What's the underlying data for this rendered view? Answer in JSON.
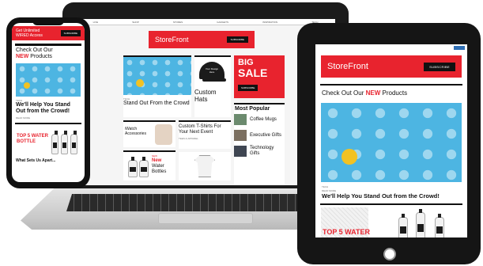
{
  "laptop": {
    "nav": [
      "LIVE",
      "SHOP",
      "STORES",
      "GADGETS",
      "INSPIRATION",
      "TECH"
    ],
    "banner": {
      "brand": "StoreFront",
      "button": "SUBSCRIBE"
    },
    "hero": {
      "tag": "TECH",
      "title": "Stand Out From the Crowd"
    },
    "hats": {
      "cap_text": "Your Design Here",
      "title": "Custom Hats"
    },
    "sale": {
      "line1": "BIG",
      "line2": "SALE",
      "button": "SUBSCRIBE"
    },
    "watch": {
      "title": "iWatch Accessories"
    },
    "tshirts": {
      "title": "Custom T-Shirts For Your Next Event",
      "tag": "TEES & APPAREL"
    },
    "bottles": {
      "tag": "NEW",
      "line1": "New",
      "line2": "Water",
      "line3": "Bottles"
    },
    "popular": {
      "title": "Most Popular",
      "items": [
        {
          "title": "Coffee Mugs"
        },
        {
          "title": "Executive Gifts"
        },
        {
          "title": "Technology Gifts"
        }
      ]
    }
  },
  "phone": {
    "banner": {
      "line1": "Get Unlimited",
      "line2": "WIRED Access",
      "button": "SUBSCRIBE"
    },
    "section": {
      "prefix": "Check Out Our",
      "highlight": "NEW",
      "suffix": "Products"
    },
    "article": {
      "tag": "TECH",
      "title": "We'll Help You Stand Out from the Crowd!",
      "meta": "READ MORE"
    },
    "promo": {
      "line1": "TOP 5 WATER",
      "line2": "BOTTLE"
    },
    "next_title": "What Sets Us Apart..."
  },
  "tablet": {
    "banner": {
      "brand": "StoreFront",
      "button": "SUBSCRIBE"
    },
    "section": {
      "prefix": "Check Out Our",
      "highlight": "NEW",
      "suffix": "Products"
    },
    "article": {
      "tag": "TECH",
      "meta": "READ MORE",
      "title": "We'll Help You Stand Out from the Crowd!"
    },
    "promo": {
      "line1": "TOP 5 WATER"
    }
  },
  "colors": {
    "brand_red": "#e8232e",
    "accent_blue": "#4db5e2",
    "ball_yellow": "#f2c222"
  }
}
